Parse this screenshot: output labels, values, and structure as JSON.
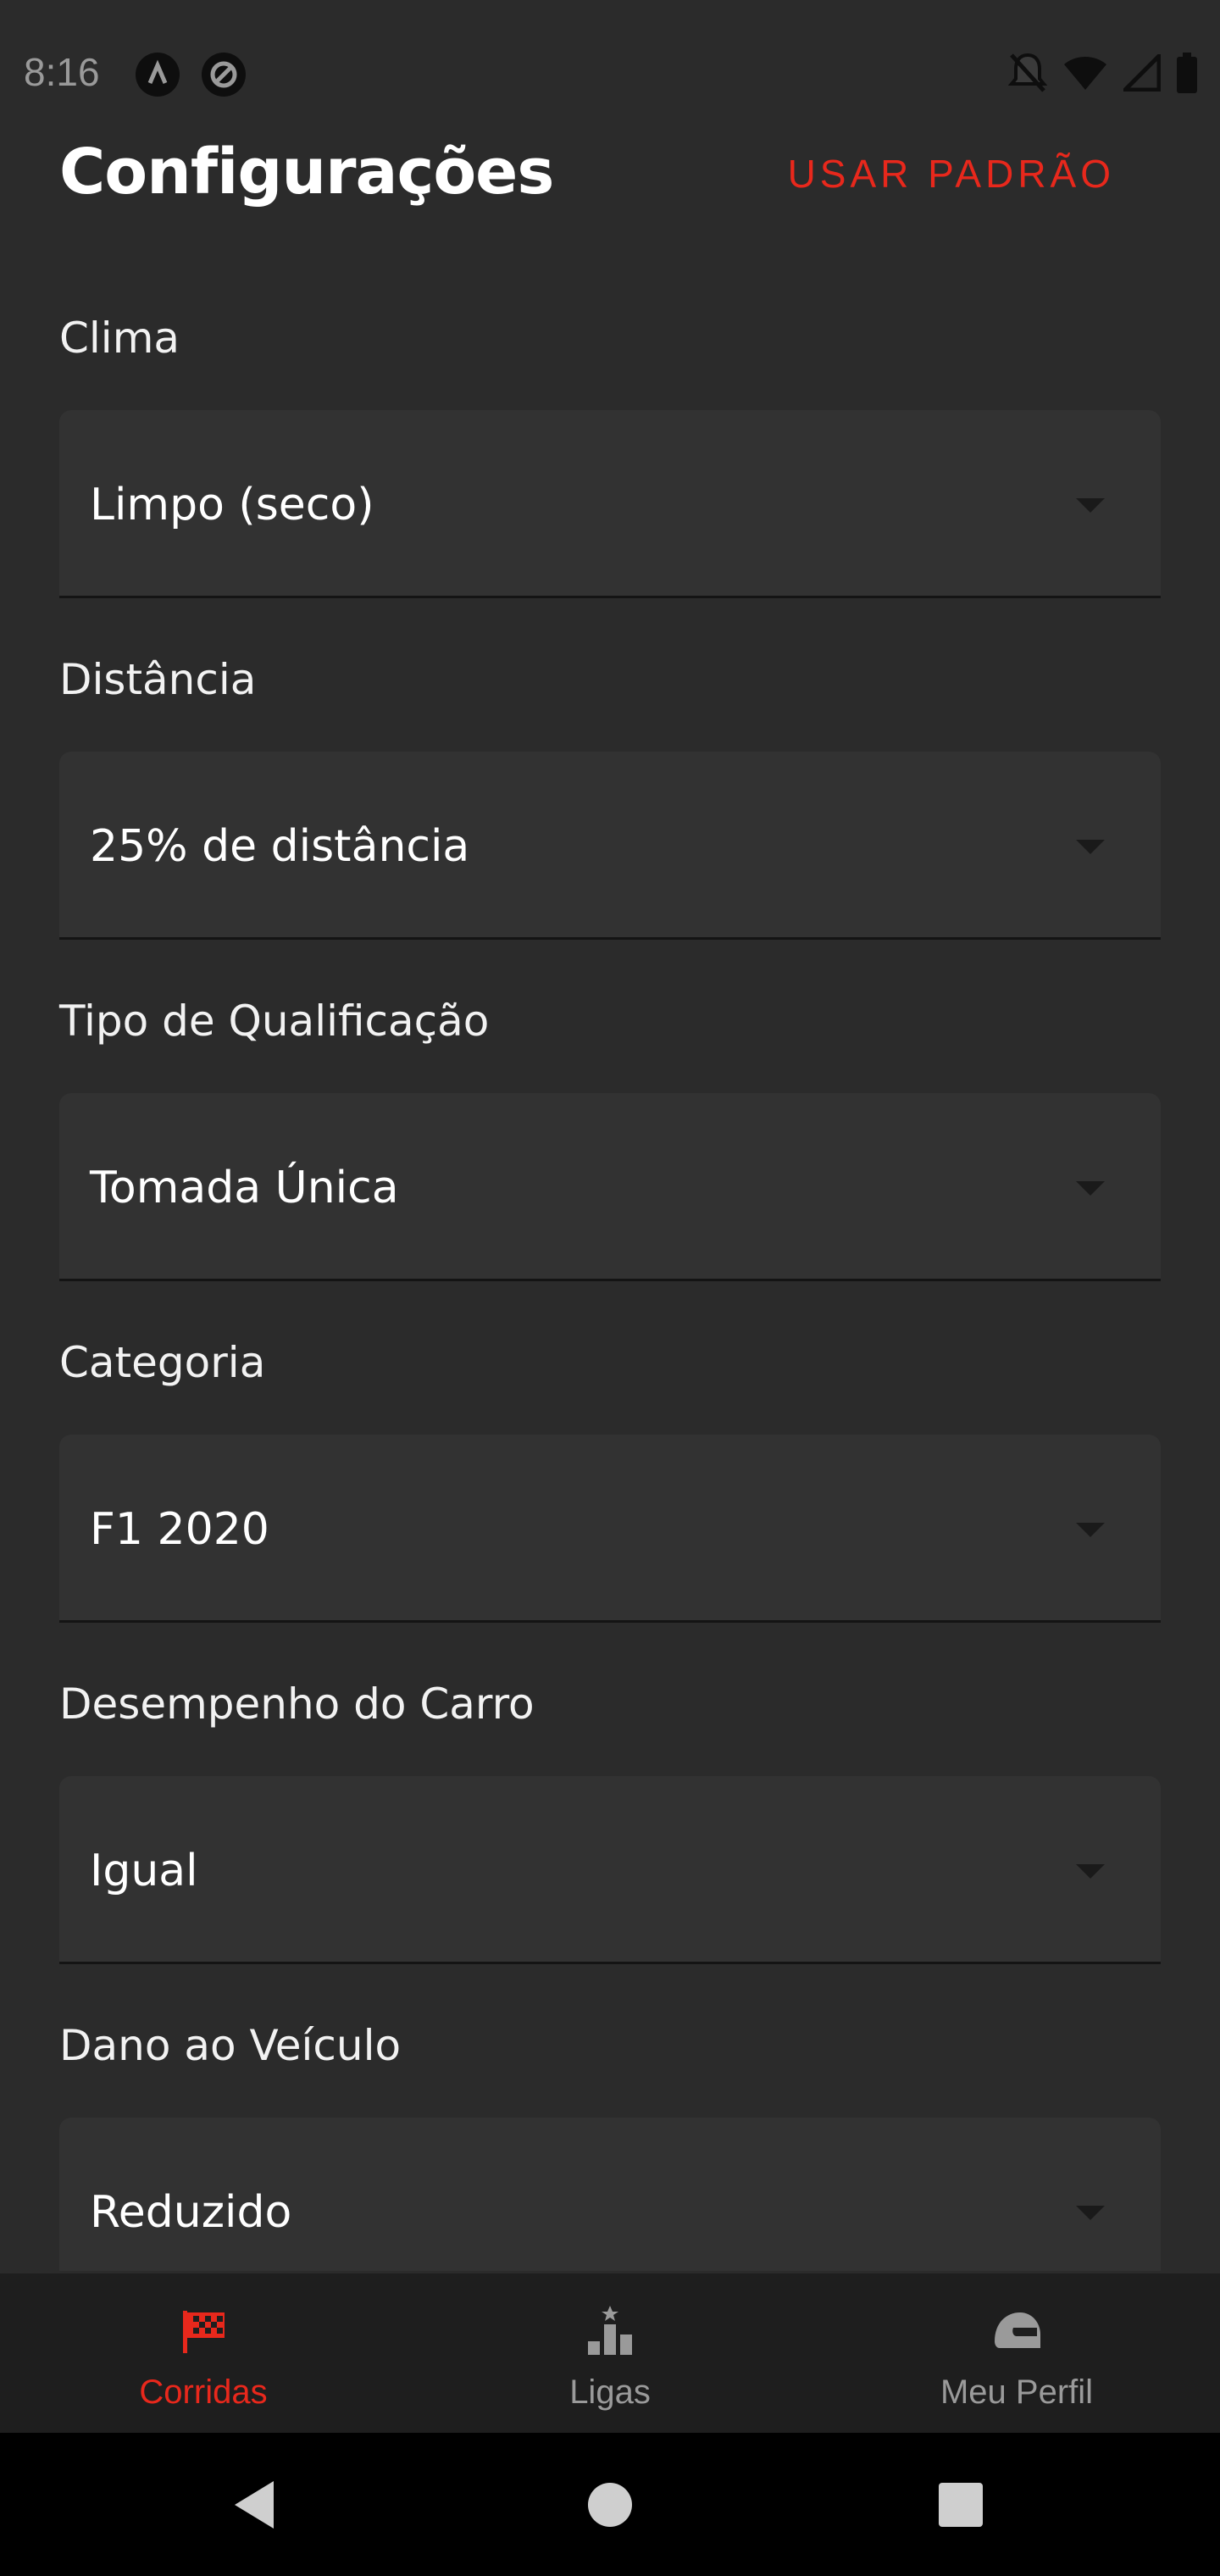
{
  "status_bar": {
    "time": "8:16",
    "icons": [
      "app-a-icon",
      "app-sync-icon",
      "notifications-off-icon",
      "wifi-icon",
      "signal-icon",
      "battery-icon"
    ]
  },
  "header": {
    "title": "Configurações",
    "default_button": "USAR PADRÃO"
  },
  "settings": [
    {
      "label": "Clima",
      "value": "Limpo (seco)"
    },
    {
      "label": "Distância",
      "value": "25% de distância"
    },
    {
      "label": "Tipo de Qualificação",
      "value": "Tomada Única"
    },
    {
      "label": "Categoria",
      "value": "F1 2020"
    },
    {
      "label": "Desempenho do Carro",
      "value": "Igual"
    },
    {
      "label": "Dano ao Veículo",
      "value": "Reduzido"
    }
  ],
  "bottom_nav": [
    {
      "label": "Corridas",
      "icon": "checkered-flag-icon",
      "active": true
    },
    {
      "label": "Ligas",
      "icon": "podium-icon",
      "active": false
    },
    {
      "label": "Meu Perfil",
      "icon": "helmet-icon",
      "active": false
    }
  ],
  "colors": {
    "accent": "#e8281c",
    "background": "#2b2b2b",
    "field": "#323232",
    "nav_background": "#1e1e1e"
  }
}
